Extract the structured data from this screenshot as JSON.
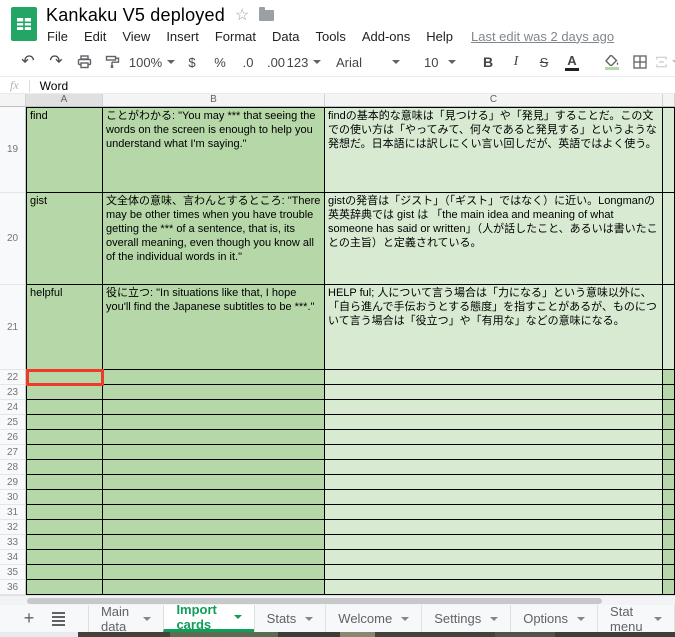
{
  "app": {
    "title": "Kankaku V5 deployed",
    "last_edit": "Last edit was 2 days ago"
  },
  "menu": {
    "items": [
      "File",
      "Edit",
      "View",
      "Insert",
      "Format",
      "Data",
      "Tools",
      "Add-ons",
      "Help"
    ]
  },
  "toolbar": {
    "zoom": "100%",
    "currency": "$",
    "percent": "%",
    "decrease_decimal": ".0",
    "increase_decimal": ".00",
    "more_formats": "123",
    "font": "Arial",
    "font_size": "10",
    "bold": "B",
    "italic": "I",
    "strikethrough": "S",
    "text_color": "A"
  },
  "icons": {
    "undo": "↶",
    "redo": "↷",
    "star": "☆",
    "plus": "+"
  },
  "formula_bar": {
    "fx": "fx",
    "value": "Word"
  },
  "grid": {
    "column_headers": [
      "A",
      "B",
      "C",
      ""
    ],
    "selected_cell": "A22",
    "content_rows": [
      {
        "num": "19",
        "word": "find",
        "sentence": "ことがわかる: \"You may *** that seeing the words on the screen is enough to help you understand what I'm saying.\"",
        "note": "findの基本的な意味は「見つける」や「発見」することだ。この文での使い方は「やってみて、何々であると発見する」というような発想だ。日本語には訳しにくい言い回しだが、英語ではよく使う。"
      },
      {
        "num": "20",
        "word": "gist",
        "sentence": "文全体の意味、言わんとするところ: \"There may be other times when you have trouble getting the *** of a sentence, that is, its overall meaning, even though you know all of the individual words in it.\"",
        "note": "gistの発音は「ジスト」（「ギスト」ではなく）に近い。Longmanの英英辞典では gist は 「the main idea and meaning of what someone has said or written」（人が話したこと、あるいは書いたことの主旨）と定義されている。"
      },
      {
        "num": "21",
        "word": "helpful",
        "sentence": "役に立つ: \"In situations like that, I hope you'll find the Japanese subtitles to be ***.\"",
        "note": "HELP ful; 人について言う場合は「力になる」という意味以外に、「自ら進んで手伝おうとする態度」を指すことがあるが、ものについて言う場合は「役立つ」や「有用な」などの意味になる。"
      }
    ],
    "empty_rows": [
      "22",
      "23",
      "24",
      "25",
      "26",
      "27",
      "28",
      "29",
      "30",
      "31",
      "32",
      "33",
      "34",
      "35",
      "36"
    ]
  },
  "tabs": {
    "items": [
      "Main data",
      "Import cards",
      "Stats",
      "Welcome",
      "Settings",
      "Options",
      "Stat menu"
    ],
    "active": "Import cards"
  },
  "colors": {
    "cell_dark_green": "#b6d7a8",
    "cell_light_green": "#d9ead3",
    "accent_green": "#0f9d58",
    "selection_red": "#ee3a28"
  }
}
